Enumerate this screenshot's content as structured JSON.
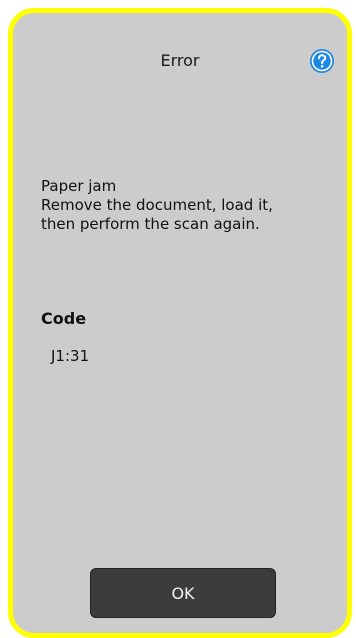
{
  "dialog": {
    "title": "Error",
    "help_icon": "question-circle-icon",
    "message_lines": [
      "Paper jam",
      "Remove the document, load it,",
      "then perform the scan again."
    ],
    "code_label": "Code",
    "code_value": "J1:31",
    "ok_label": "OK"
  },
  "colors": {
    "highlight_border": "#ffff00",
    "dialog_background": "#cccccc",
    "button_background": "#3c3c3c",
    "help_icon_fill": "#1e88e5"
  }
}
